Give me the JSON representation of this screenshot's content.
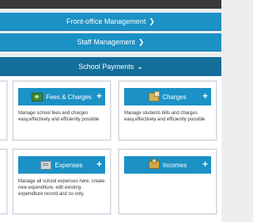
{
  "nav": {
    "front_office": "Front-office Management",
    "staff": "Staff Management",
    "school_payments": "School Payments"
  },
  "cards": {
    "fees_charges": {
      "title": "Fees & Charges",
      "desc": "Manage school fees and charges easy,effectively and efficiently possible",
      "icon": "money-icon"
    },
    "charges": {
      "title": "Charges",
      "desc": "Manage students bills and charges easy,effectively and efficiently possible",
      "icon": "charges-icon"
    },
    "expenses": {
      "title": "Expenses",
      "desc": "Manage all school expenses here, create new expenditure, edit existing expenditure record and so only.",
      "icon": "expenses-icon"
    },
    "incomes": {
      "title": "Incomes",
      "desc": "",
      "icon": "incomes-icon"
    }
  },
  "plus_symbol": "+",
  "colors": {
    "primary": "#1b91c5",
    "active_bar": "#136f99",
    "topbar": "#3a3a3a",
    "background": "#eceef0"
  }
}
